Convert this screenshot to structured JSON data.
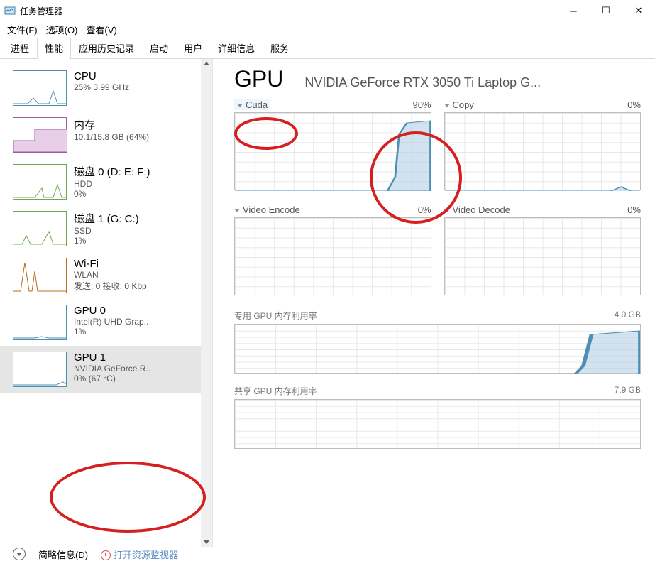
{
  "window": {
    "title": "任务管理器"
  },
  "menu": {
    "file": "文件(F)",
    "options": "选项(O)",
    "view": "查看(V)"
  },
  "tabs": [
    "进程",
    "性能",
    "应用历史记录",
    "启动",
    "用户",
    "详细信息",
    "服务"
  ],
  "active_tab": 1,
  "sidebar": [
    {
      "title": "CPU",
      "line2": "25%  3.99 GHz",
      "line3": "",
      "color": "#4e8fb5"
    },
    {
      "title": "内存",
      "line2": "10.1/15.8 GB (64%)",
      "line3": "",
      "color": "#a15ca3"
    },
    {
      "title": "磁盘 0 (D: E: F:)",
      "line2": "HDD",
      "line3": "0%",
      "color": "#6fa84f"
    },
    {
      "title": "磁盘 1 (G: C:)",
      "line2": "SSD",
      "line3": "1%",
      "color": "#6fa84f"
    },
    {
      "title": "Wi-Fi",
      "line2": "WLAN",
      "line3": "发送: 0 接收: 0 Kbp",
      "color": "#bf6b1b"
    },
    {
      "title": "GPU 0",
      "line2": "Intel(R) UHD Grap..",
      "line3": "1%",
      "color": "#4e8fb5"
    },
    {
      "title": "GPU 1",
      "line2": "NVIDIA GeForce R..",
      "line3": "0% (67 °C)",
      "color": "#4e8fb5"
    }
  ],
  "selected_sidebar": 6,
  "detail": {
    "heading": "GPU",
    "subheading": "NVIDIA GeForce RTX 3050 Ti Laptop G...",
    "charts": [
      {
        "label": "Cuda",
        "value": "90%"
      },
      {
        "label": "Copy",
        "value": "0%"
      },
      {
        "label": "Video Encode",
        "value": "0%"
      },
      {
        "label": "Video Decode",
        "value": "0%"
      }
    ],
    "mem1": {
      "label": "专用 GPU 内存利用率",
      "right": "4.0 GB"
    },
    "mem2": {
      "label": "共享 GPU 内存利用率",
      "right": "7.9 GB"
    }
  },
  "footer": {
    "brief": "简略信息(D)",
    "resmon": "打开资源监视器"
  },
  "chart_data": {
    "type": "line",
    "title": "NVIDIA GeForce RTX 3050 Ti usage",
    "series": [
      {
        "name": "Cuda",
        "current_percent": 90,
        "values_percent": [
          0,
          0,
          0,
          0,
          0,
          0,
          0,
          5,
          70,
          90
        ],
        "ylim": [
          0,
          100
        ]
      },
      {
        "name": "Copy",
        "current_percent": 0,
        "values_percent": [
          0,
          0,
          0,
          0,
          0,
          0,
          0,
          0,
          2,
          0
        ],
        "ylim": [
          0,
          100
        ]
      },
      {
        "name": "Video Encode",
        "current_percent": 0,
        "values_percent": [
          0,
          0,
          0,
          0,
          0,
          0,
          0,
          0,
          0,
          0
        ],
        "ylim": [
          0,
          100
        ]
      },
      {
        "name": "Video Decode",
        "current_percent": 0,
        "values_percent": [
          0,
          0,
          0,
          0,
          0,
          0,
          0,
          0,
          0,
          0
        ],
        "ylim": [
          0,
          100
        ]
      },
      {
        "name": "Dedicated GPU memory",
        "current_gb": 3.6,
        "max_gb": 4.0,
        "values_gb": [
          0,
          0,
          0,
          0,
          0,
          0,
          0,
          0.2,
          3.4,
          3.6
        ]
      },
      {
        "name": "Shared GPU memory",
        "current_gb": 0.0,
        "max_gb": 7.9,
        "values_gb": [
          0,
          0,
          0,
          0,
          0,
          0,
          0,
          0,
          0,
          0
        ]
      }
    ]
  }
}
